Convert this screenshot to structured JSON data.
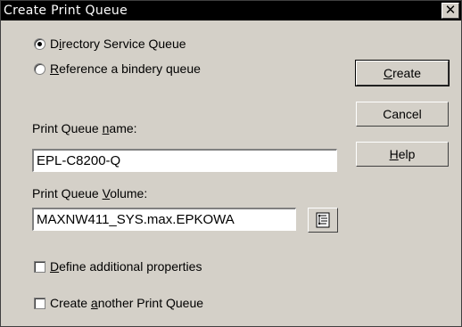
{
  "window": {
    "title": "Create Print Queue",
    "close_glyph": "✕"
  },
  "queue_type": {
    "directory_service": {
      "label_pre": "D",
      "label_acc": "i",
      "label_post": "rectory Service Queue",
      "selected": true
    },
    "bindery": {
      "label_pre": "",
      "label_acc": "R",
      "label_post": "eference a bindery queue",
      "selected": false
    }
  },
  "name_field": {
    "label_pre": "Print Queue ",
    "label_acc": "n",
    "label_post": "ame:",
    "value": "EPL-C8200-Q"
  },
  "volume_field": {
    "label_pre": "Print Queue ",
    "label_acc": "V",
    "label_post": "olume:",
    "value": "MAXNW411_SYS.max.EPKOWA",
    "browse_icon": "tree-browse-icon"
  },
  "options": {
    "define_additional": {
      "label_pre": "",
      "label_acc": "D",
      "label_post": "efine additional properties",
      "checked": false
    },
    "create_another": {
      "label_pre": "Create ",
      "label_acc": "a",
      "label_post": "nother Print Queue",
      "checked": false
    }
  },
  "buttons": {
    "create": {
      "label_pre": "",
      "label_acc": "C",
      "label_post": "reate"
    },
    "cancel": {
      "label": "Cancel"
    },
    "help": {
      "label_pre": "",
      "label_acc": "H",
      "label_post": "elp"
    }
  }
}
